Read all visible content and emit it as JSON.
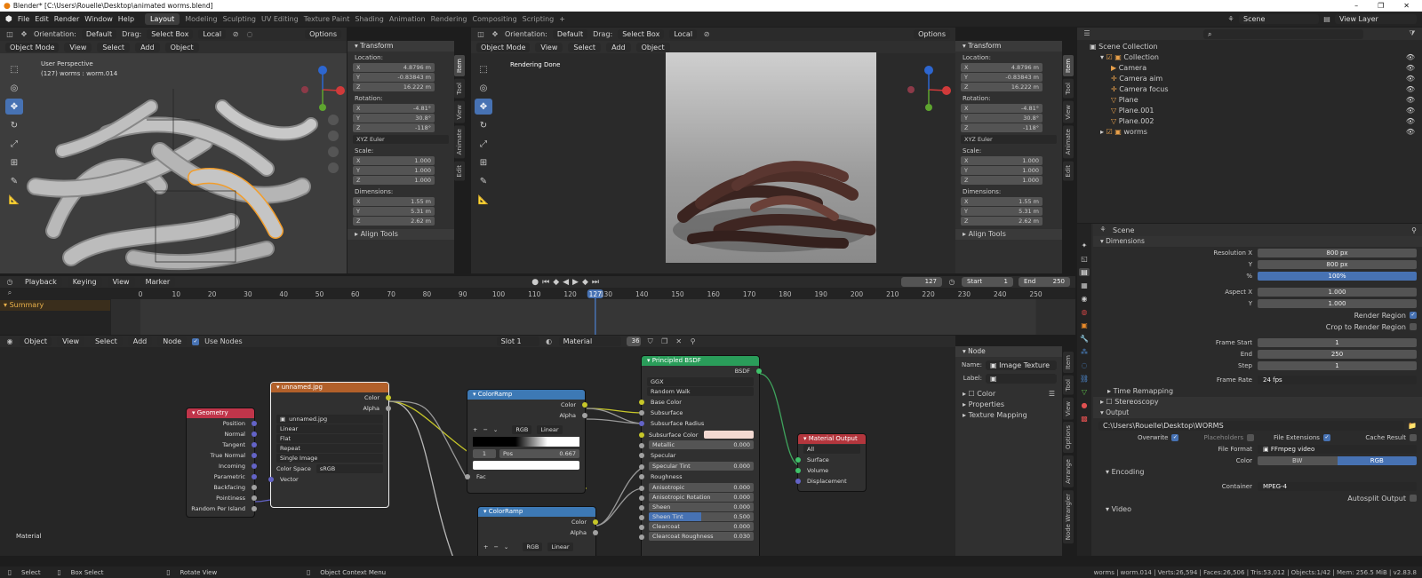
{
  "window": {
    "title": "Blender* [C:\\Users\\Rouelle\\Desktop\\animated worms.blend]",
    "controls": [
      "–",
      "❐",
      "✕"
    ]
  },
  "topbar": {
    "menus": [
      "File",
      "Edit",
      "Render",
      "Window",
      "Help"
    ],
    "workspaces": [
      "Layout",
      "Modeling",
      "Sculpting",
      "UV Editing",
      "Texture Paint",
      "Shading",
      "Animation",
      "Rendering",
      "Compositing",
      "Scripting"
    ],
    "active_workspace": "Layout",
    "add_tab": "+",
    "scene": "Scene",
    "view_layer": "View Layer"
  },
  "vp1": {
    "orientation_label": "Orientation:",
    "orientation": "Default",
    "drag_label": "Drag:",
    "drag": "Select Box",
    "transform": "Local",
    "options": "Options",
    "mode": "Object Mode",
    "menus": [
      "View",
      "Select",
      "Add",
      "Object"
    ],
    "info_line1": "User Perspective",
    "info_line2": "(127) worms : worm.014"
  },
  "vp2": {
    "orientation_label": "Orientation:",
    "orientation": "Default",
    "drag_label": "Drag:",
    "drag": "Select Box",
    "transform": "Local",
    "options": "Options",
    "mode": "Object Mode",
    "menus": [
      "View",
      "Select",
      "Add",
      "Object"
    ],
    "status": "Rendering Done"
  },
  "transform_panel": {
    "title": "Transform",
    "location_label": "Location:",
    "location": [
      [
        "X",
        "4.8796 m"
      ],
      [
        "Y",
        "-0.83843 m"
      ],
      [
        "Z",
        "16.222 m"
      ]
    ],
    "rotation_label": "Rotation:",
    "rotation": [
      [
        "X",
        "-4.81°"
      ],
      [
        "Y",
        "30.8°"
      ],
      [
        "Z",
        "-118°"
      ]
    ],
    "euler": "XYZ Euler",
    "scale_label": "Scale:",
    "scale": [
      [
        "X",
        "1.000"
      ],
      [
        "Y",
        "1.000"
      ],
      [
        "Z",
        "1.000"
      ]
    ],
    "dimensions_label": "Dimensions:",
    "dimensions": [
      [
        "X",
        "1.55 m"
      ],
      [
        "Y",
        "5.31 m"
      ],
      [
        "Z",
        "2.62 m"
      ]
    ],
    "align_tools": "Align Tools"
  },
  "side_tabs1": [
    "Item",
    "Tool",
    "View",
    "Animate",
    "Edit"
  ],
  "outliner": {
    "root": "Scene Collection",
    "items": [
      {
        "name": "Collection",
        "depth": 1
      },
      {
        "name": "Camera",
        "depth": 2
      },
      {
        "name": "Camera aim",
        "depth": 2
      },
      {
        "name": "Camera focus",
        "depth": 2
      },
      {
        "name": "Plane",
        "depth": 2
      },
      {
        "name": "Plane.001",
        "depth": 2
      },
      {
        "name": "Plane.002",
        "depth": 2
      },
      {
        "name": "worms",
        "depth": 1
      }
    ]
  },
  "timeline": {
    "menus": [
      "Playback",
      "Keying",
      "View",
      "Marker"
    ],
    "current_frame": "127",
    "start_label": "Start",
    "start": "1",
    "end_label": "End",
    "end": "250",
    "ticks": [
      "0",
      "10",
      "20",
      "30",
      "40",
      "50",
      "60",
      "70",
      "80",
      "90",
      "100",
      "110",
      "120",
      "127",
      "130",
      "140",
      "150",
      "160",
      "170",
      "180",
      "190",
      "200",
      "210",
      "220",
      "230",
      "240",
      "250"
    ],
    "summary": "Summary"
  },
  "node_editor": {
    "type": "Object",
    "menus": [
      "View",
      "Select",
      "Add",
      "Node"
    ],
    "use_nodes": "Use Nodes",
    "slot": "Slot 1",
    "material": "Material",
    "users": "36",
    "label": "Material"
  },
  "nodes": {
    "geometry": {
      "title": "Geometry",
      "outputs": [
        "Position",
        "Normal",
        "Tangent",
        "True Normal",
        "Incoming",
        "Parametric",
        "Backfacing",
        "Pointiness",
        "Random Per Island"
      ]
    },
    "image": {
      "title": "unnamed.jpg",
      "outputs": [
        "Color",
        "Alpha"
      ],
      "image": "unnamed.jpg",
      "interp": "Linear",
      "proj": "Flat",
      "ext": "Repeat",
      "source": "Single Image",
      "cs_label": "Color Space",
      "cs": "sRGB",
      "input": "Vector"
    },
    "ramp1": {
      "title": "ColorRamp",
      "outputs": [
        "Color",
        "Alpha"
      ],
      "mode": "RGB",
      "interp": "Linear",
      "index": "1",
      "pos_label": "Pos",
      "pos": "0.667",
      "input": "Fac"
    },
    "ramp2": {
      "title": "ColorRamp",
      "outputs": [
        "Color",
        "Alpha"
      ],
      "mode": "RGB",
      "interp": "Linear"
    },
    "bsdf": {
      "title": "Principled BSDF",
      "output": "BSDF",
      "dist": "GGX",
      "sss": "Random Walk",
      "rows": [
        [
          "Base Color",
          ""
        ],
        [
          "Subsurface",
          ""
        ],
        [
          "Subsurface Radius",
          ""
        ],
        [
          "Subsurface Color",
          ""
        ],
        [
          "Metallic",
          "0.000"
        ],
        [
          "Specular",
          ""
        ],
        [
          "Specular Tint",
          "0.000"
        ],
        [
          "Roughness",
          ""
        ],
        [
          "Anisotropic",
          "0.000"
        ],
        [
          "Anisotropic Rotation",
          "0.000"
        ],
        [
          "Sheen",
          "0.000"
        ],
        [
          "Sheen Tint",
          "0.500"
        ],
        [
          "Clearcoat",
          "0.000"
        ],
        [
          "Clearcoat Roughness",
          "0.030"
        ]
      ]
    },
    "output": {
      "title": "Material Output",
      "target": "All",
      "inputs": [
        "Surface",
        "Volume",
        "Displacement"
      ]
    }
  },
  "node_panel": {
    "title": "Node",
    "name_label": "Name:",
    "name": "Image Texture",
    "label_label": "Label:",
    "color": "Color",
    "properties": "Properties",
    "texture_mapping": "Texture Mapping"
  },
  "side_tabs2": [
    "Item",
    "Tool",
    "View",
    "Options",
    "Arrange",
    "Node Wrangler"
  ],
  "properties": {
    "scene": "Scene",
    "dimensions": "Dimensions",
    "res_x_label": "Resolution X",
    "res_x": "800 px",
    "res_y_label": "Y",
    "res_y": "800 px",
    "pct_label": "%",
    "pct": "100%",
    "aspect_x_label": "Aspect X",
    "aspect_x": "1.000",
    "aspect_y_label": "Y",
    "aspect_y": "1.000",
    "render_region": "Render Region",
    "crop": "Crop to Render Region",
    "frame_start_label": "Frame Start",
    "frame_start": "1",
    "end_label": "End",
    "end": "250",
    "step_label": "Step",
    "step": "1",
    "frame_rate_label": "Frame Rate",
    "frame_rate": "24 fps",
    "time_remapping": "Time Remapping",
    "stereoscopy": "Stereoscopy",
    "output": "Output",
    "path": "C:\\Users\\Rouelle\\Desktop\\WORMS",
    "overwrite": "Overwrite",
    "placeholders": "Placeholders",
    "file_ext": "File Extensions",
    "cache_result": "Cache Result",
    "file_format_label": "File Format",
    "file_format": "FFmpeg video",
    "color_label": "Color",
    "bw": "BW",
    "rgb": "RGB",
    "encoding": "Encoding",
    "container_label": "Container",
    "container": "MPEG-4",
    "autosplit": "Autosplit Output",
    "video": "Video"
  },
  "statusbar": {
    "select": "Select",
    "box_select": "Box Select",
    "rotate": "Rotate View",
    "context": "Object Context Menu",
    "stats": "worms | worm.014 | Verts:26,594 | Faces:26,506 | Tris:53,012 | Objects:1/42 | Mem: 256.5 MiB | v2.83.8"
  },
  "colors": {
    "accent": "#4772b3",
    "selected": "#f29d2b",
    "geometry": "#c0354a",
    "image": "#b2602a",
    "converter": "#3d79b5",
    "shader": "#2a9d5a",
    "output": "#b3363d"
  }
}
